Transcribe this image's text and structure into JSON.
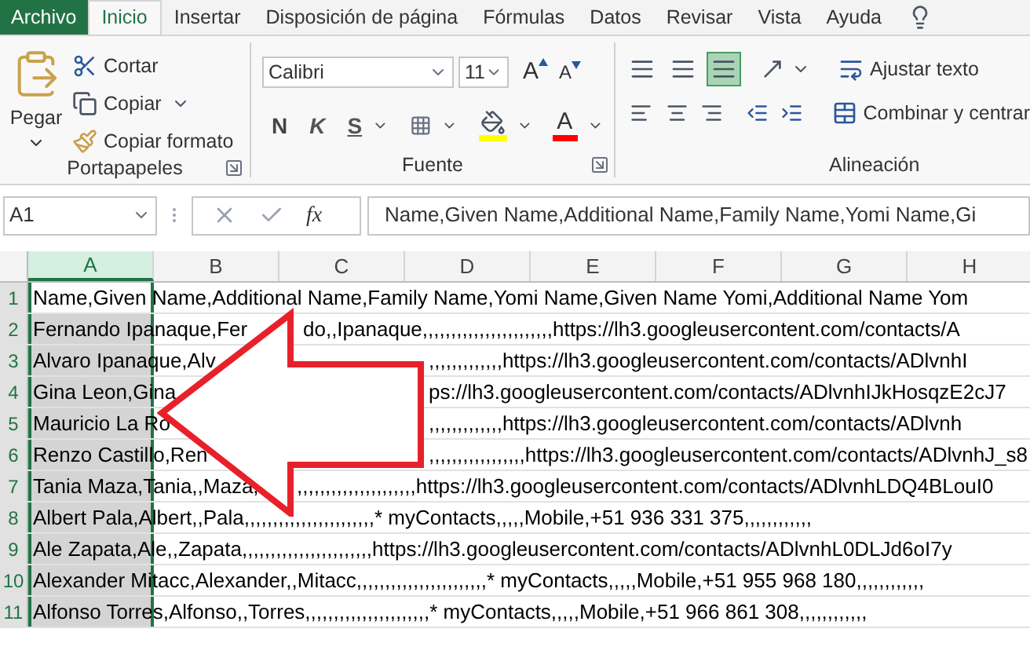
{
  "tabs": [
    {
      "label": "Archivo",
      "kind": "file",
      "selected": false
    },
    {
      "label": "Inicio",
      "kind": "tab",
      "selected": true
    },
    {
      "label": "Insertar",
      "kind": "tab",
      "selected": false
    },
    {
      "label": "Disposición de página",
      "kind": "tab",
      "selected": false
    },
    {
      "label": "Fórmulas",
      "kind": "tab",
      "selected": false
    },
    {
      "label": "Datos",
      "kind": "tab",
      "selected": false
    },
    {
      "label": "Revisar",
      "kind": "tab",
      "selected": false
    },
    {
      "label": "Vista",
      "kind": "tab",
      "selected": false
    },
    {
      "label": "Ayuda",
      "kind": "tab",
      "selected": false
    }
  ],
  "clipboard": {
    "paste": "Pegar",
    "cut": "Cortar",
    "copy": "Copiar",
    "format_painter": "Copiar formato",
    "group_label": "Portapapeles"
  },
  "font": {
    "name": "Calibri",
    "size": "11",
    "grow": "A",
    "shrink": "A",
    "bold": "N",
    "italic": "K",
    "underline": "S",
    "font_color": "A",
    "group_label": "Fuente"
  },
  "alignment": {
    "vertical_buttons": [
      {
        "selected": false
      },
      {
        "selected": false
      },
      {
        "selected": true
      }
    ],
    "wrap_text": "Ajustar texto",
    "merge": "Combinar y centrar",
    "group_label": "Alineación"
  },
  "formula_bar": {
    "name_box": "A1",
    "function_label": "fx",
    "value": "Name,Given Name,Additional Name,Family Name,Yomi Name,Gi"
  },
  "columns": [
    {
      "label": "A",
      "selected": true
    },
    {
      "label": "B",
      "selected": false
    },
    {
      "label": "C",
      "selected": false
    },
    {
      "label": "D",
      "selected": false
    },
    {
      "label": "E",
      "selected": false
    },
    {
      "label": "F",
      "selected": false
    },
    {
      "label": "G",
      "selected": false
    },
    {
      "label": "H",
      "selected": false
    }
  ],
  "rows": [
    {
      "number": "1",
      "segments": [
        "Name,Given Name,Additional Name,Family Name,Yomi Name,Given Name Yomi,Additional Name Yom"
      ]
    },
    {
      "number": "2",
      "segments": [
        "Fernando Ipanaque,Fer",
        "do,,Ipanaque,,,,,,,,,,,,,,,,,,,,,,,https://lh3.googleusercontent.com/contacts/A"
      ]
    },
    {
      "number": "3",
      "segments": [
        "Alvaro Ipanaque,Alv",
        ",,,,,,,,,,,,,https://lh3.googleusercontent.com/contacts/ADlvnhI"
      ]
    },
    {
      "number": "4",
      "segments": [
        "Gina Leon,Gina",
        "ps://lh3.googleusercontent.com/contacts/ADlvnhIJkHosqzE2cJ7"
      ]
    },
    {
      "number": "5",
      "segments": [
        "Mauricio La Ro",
        ",,,,,,,,,,,,,https://lh3.googleusercontent.com/contacts/ADlvnh"
      ]
    },
    {
      "number": "6",
      "segments": [
        "Renzo Castillo,Ren",
        ",,,,,,,,,,,,,,,,,https://lh3.googleusercontent.com/contacts/ADlvnhJ_s8"
      ]
    },
    {
      "number": "7",
      "segments": [
        "Tania Maza,Tania,,Maza,",
        ",,,,,,,,,,,,,,,,,,,,,https://lh3.googleusercontent.com/contacts/ADlvnhLDQ4BLouI0"
      ]
    },
    {
      "number": "8",
      "segments": [
        "Albert Pala,Albert,,Pala,,,,,,,,,,,,,,,,,,,,,,,* myContacts,,,,,Mobile,+51 936 331 375,,,,,,,,,,,,"
      ]
    },
    {
      "number": "9",
      "segments": [
        "Ale Zapata,Ale,,Zapata,,,,,,,,,,,,,,,,,,,,,,,https://lh3.googleusercontent.com/contacts/ADlvnhL0DLJd6oI7y"
      ]
    },
    {
      "number": "10",
      "segments": [
        "Alexander Mitacc,Alexander,,Mitacc,,,,,,,,,,,,,,,,,,,,,,,* myContacts,,,,,Mobile,+51 955 968 180,,,,,,,,,,,,"
      ]
    },
    {
      "number": "11",
      "segments": [
        "Alfonso Torres,Alfonso,,Torres,,,,,,,,,,,,,,,,,,,,,,* myContacts,,,,,Mobile,+51 966 861 308,,,,,,,,,,,,"
      ]
    }
  ]
}
